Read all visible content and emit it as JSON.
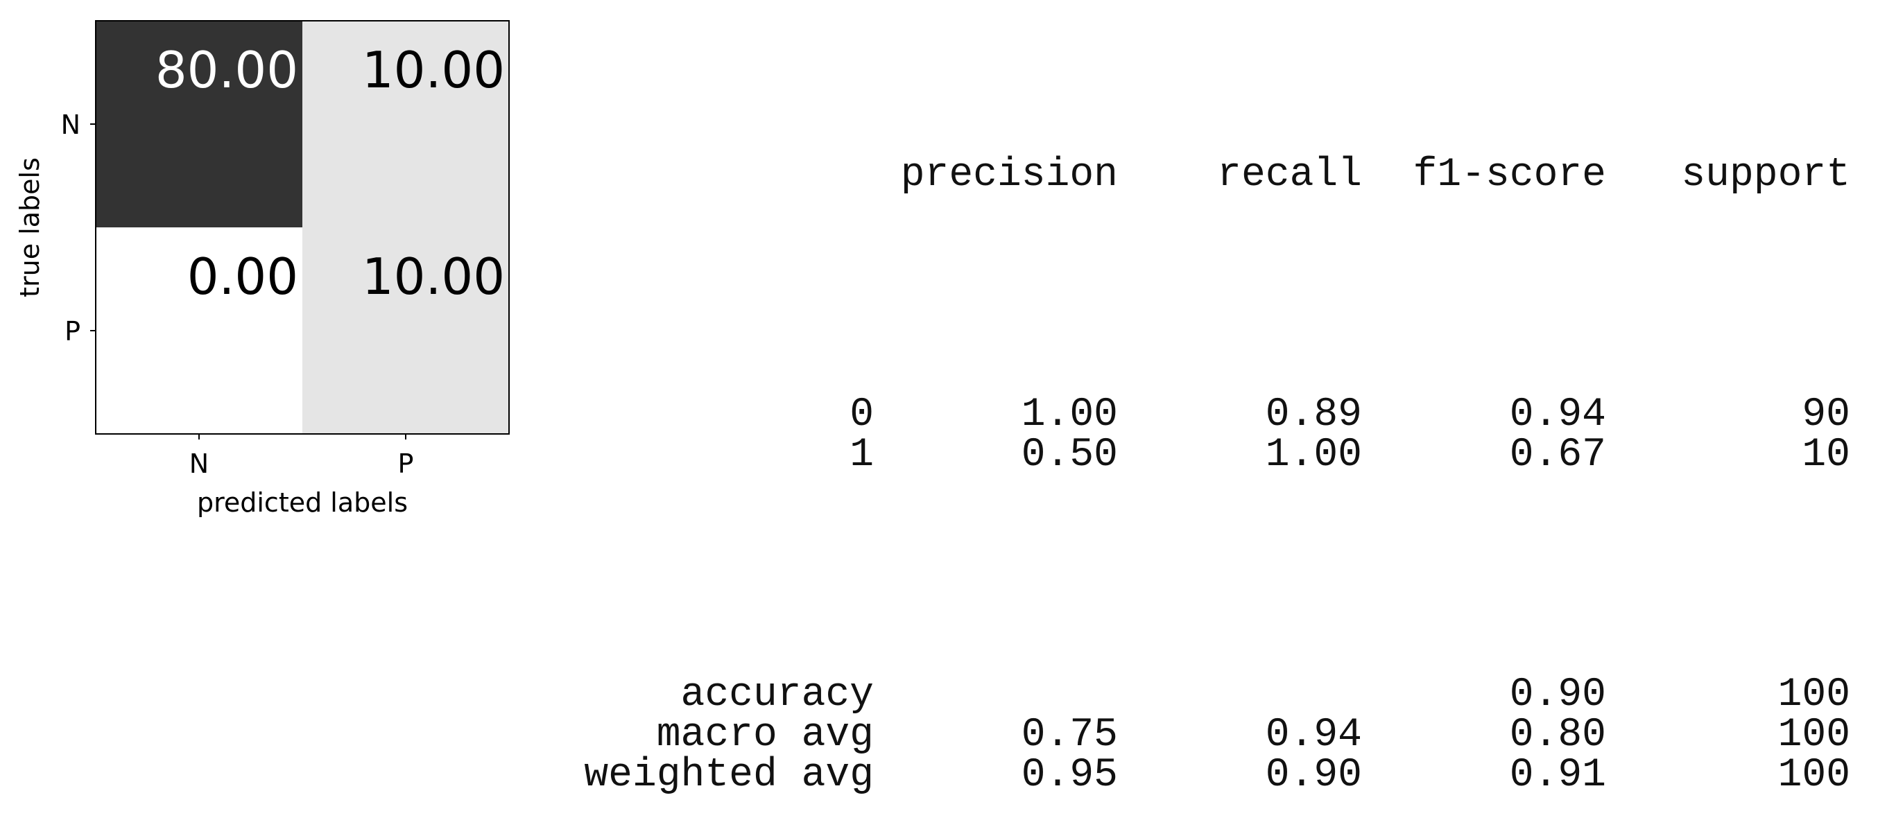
{
  "chart_data": [
    {
      "type": "heatmap",
      "xlabel": "predicted labels",
      "ylabel": "true labels",
      "x_categories": [
        "N",
        "P"
      ],
      "y_categories": [
        "N",
        "P"
      ],
      "values": [
        [
          80.0,
          10.0
        ],
        [
          0.0,
          10.0
        ]
      ],
      "cell_labels": [
        [
          "80.00",
          "10.00"
        ],
        [
          "0.00",
          "10.00"
        ]
      ],
      "colormap": "gray_r",
      "cell_colors": [
        [
          "#333333",
          "#e5e5e5"
        ],
        [
          "#ffffff",
          "#e5e5e5"
        ]
      ],
      "cell_text_colors": [
        [
          "#ffffff",
          "#000000"
        ],
        [
          "#000000",
          "#000000"
        ]
      ]
    },
    {
      "type": "table",
      "columns": [
        "",
        "precision",
        "recall",
        "f1-score",
        "support"
      ],
      "class_rows": [
        {
          "label": "0",
          "precision": "1.00",
          "recall": "0.89",
          "f1": "0.94",
          "support": "90"
        },
        {
          "label": "1",
          "precision": "0.50",
          "recall": "1.00",
          "f1": "0.67",
          "support": "10"
        }
      ],
      "summary_rows": [
        {
          "label": "accuracy",
          "precision": "",
          "recall": "",
          "f1": "0.90",
          "support": "100"
        },
        {
          "label": "macro avg",
          "precision": "0.75",
          "recall": "0.94",
          "f1": "0.80",
          "support": "100"
        },
        {
          "label": "weighted avg",
          "precision": "0.95",
          "recall": "0.90",
          "f1": "0.91",
          "support": "100"
        }
      ]
    }
  ]
}
